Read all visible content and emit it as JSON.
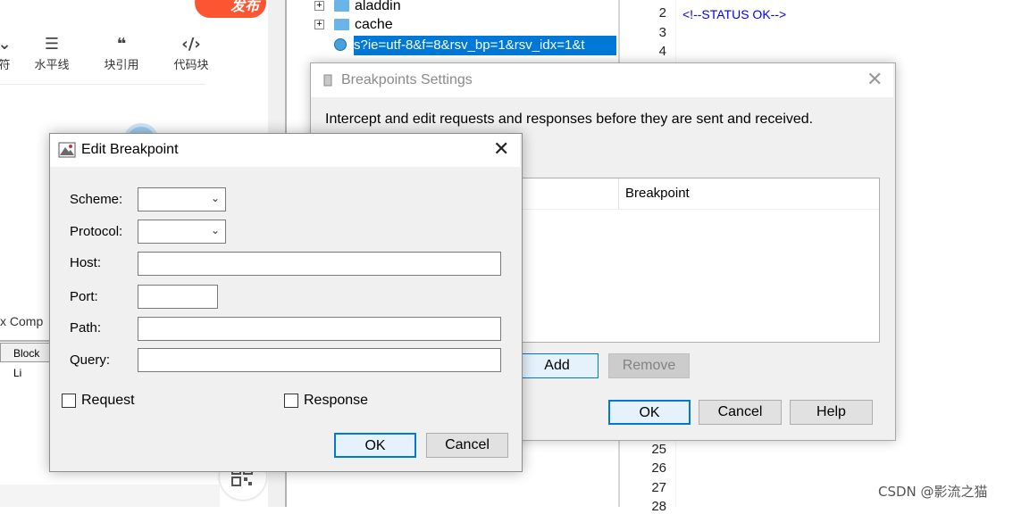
{
  "blog_editor": {
    "publish_label": "发布",
    "toolbar": [
      {
        "icon": "minus-icon",
        "glyph": "‒",
        "label": "符"
      },
      {
        "icon": "horizontal-rule-icon",
        "glyph": "☰",
        "label": "水平线"
      },
      {
        "icon": "blockquote-icon",
        "glyph": "❝",
        "label": "块引用"
      },
      {
        "icon": "code-block-icon",
        "glyph": "‹/›",
        "label": "代码块"
      }
    ],
    "comp_label": "x  Comp",
    "block_list_tab": "Block Li"
  },
  "tree": {
    "items": [
      {
        "label": "aladdin",
        "expand": "+"
      },
      {
        "label": "cache",
        "expand": "+"
      }
    ],
    "selected_label": "s?ie=utf-8&f=8&rsv_bp=1&rsv_idx=1&t",
    "partial_row": "s?ie=...&rsv_bp=1&rsv_idx=1&t"
  },
  "code": {
    "line_numbers_top": [
      "2",
      "3",
      "4"
    ],
    "line_numbers_bottom": [
      "25",
      "26",
      "27",
      "28"
    ],
    "status_line": "<!--STATUS OK-->"
  },
  "breakpoints_settings": {
    "title": "Breakpoints Settings",
    "description": "Intercept and edit requests and responses before they are sent and received.",
    "column_header": "Breakpoint",
    "add_label": "Add",
    "remove_label": "Remove",
    "ok_label": "OK",
    "cancel_label": "Cancel",
    "help_label": "Help"
  },
  "edit_breakpoint": {
    "title": "Edit Breakpoint",
    "scheme_label": "Scheme:",
    "protocol_label": "Protocol:",
    "host_label": "Host:",
    "port_label": "Port:",
    "path_label": "Path:",
    "query_label": "Query:",
    "scheme_value": "",
    "protocol_value": "",
    "host_value": "",
    "port_value": "",
    "path_value": "",
    "query_value": "",
    "request_label": "Request",
    "response_label": "Response",
    "request_checked": false,
    "response_checked": false,
    "ok_label": "OK",
    "cancel_label": "Cancel"
  },
  "watermark": "CSDN @影流之猫",
  "colors": {
    "selection": "#0078d7",
    "publish": "#fc5531",
    "code_text": "#0000ff"
  }
}
